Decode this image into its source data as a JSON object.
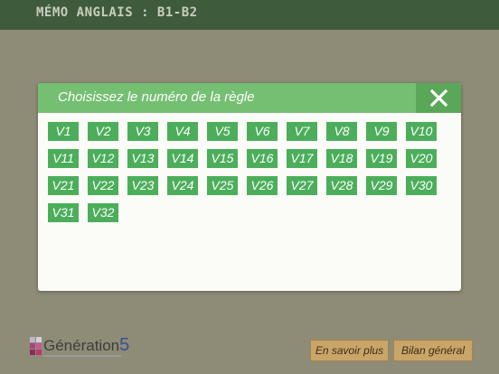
{
  "header": {
    "title": "MÉMO ANGLAIS : B1-B2"
  },
  "modal": {
    "title": "Choisissez le numéro de la règle",
    "close_icon": "close-x-icon",
    "rules": [
      "V1",
      "V2",
      "V3",
      "V4",
      "V5",
      "V6",
      "V7",
      "V8",
      "V9",
      "V10",
      "V11",
      "V12",
      "V13",
      "V14",
      "V15",
      "V16",
      "V17",
      "V18",
      "V19",
      "V20",
      "V21",
      "V22",
      "V23",
      "V24",
      "V25",
      "V26",
      "V27",
      "V28",
      "V29",
      "V30",
      "V31",
      "V32"
    ]
  },
  "footer": {
    "logo_text": "Génération",
    "logo_number": "5",
    "more_label": "En savoir plus",
    "summary_label": "Bilan général"
  },
  "colors": {
    "background": "#8e8c77",
    "topbar": "#3e5b3b",
    "modal_header": "#75bf72",
    "rule_button": "#4cae5b",
    "footer_button": "#c9a56a"
  }
}
